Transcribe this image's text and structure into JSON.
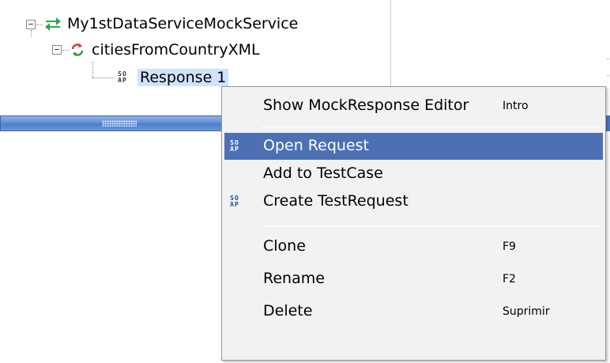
{
  "tree": {
    "service_label": "My1stDataServiceMockService",
    "service_icon": "mock-service-icon",
    "operation_label": "citiesFromCountryXML",
    "operation_icon": "mock-operation-icon",
    "response_label": "Response 1",
    "response_icon_text": "SO AP"
  },
  "context_menu": {
    "items": [
      {
        "label": "Show MockResponse Editor",
        "shortcut": "Intro",
        "icon": ""
      },
      {
        "label": "Open Request",
        "shortcut": "",
        "icon": "SO AP",
        "highlighted": true
      },
      {
        "label": "Add to TestCase",
        "shortcut": "",
        "icon": ""
      },
      {
        "label": "Create TestRequest",
        "shortcut": "",
        "icon": "SO AP"
      },
      {
        "label": "Clone",
        "shortcut": "F9",
        "icon": ""
      },
      {
        "label": "Rename",
        "shortcut": "F2",
        "icon": ""
      },
      {
        "label": "Delete",
        "shortcut": "Suprimir",
        "icon": ""
      }
    ]
  },
  "colors": {
    "selection_bg": "#cfe3ff",
    "menu_highlight": "#4c70b3",
    "menu_bg": "#f2f2f2",
    "scrollbar": "#5f8fd6",
    "service_icon_green": "#2aa84a"
  }
}
